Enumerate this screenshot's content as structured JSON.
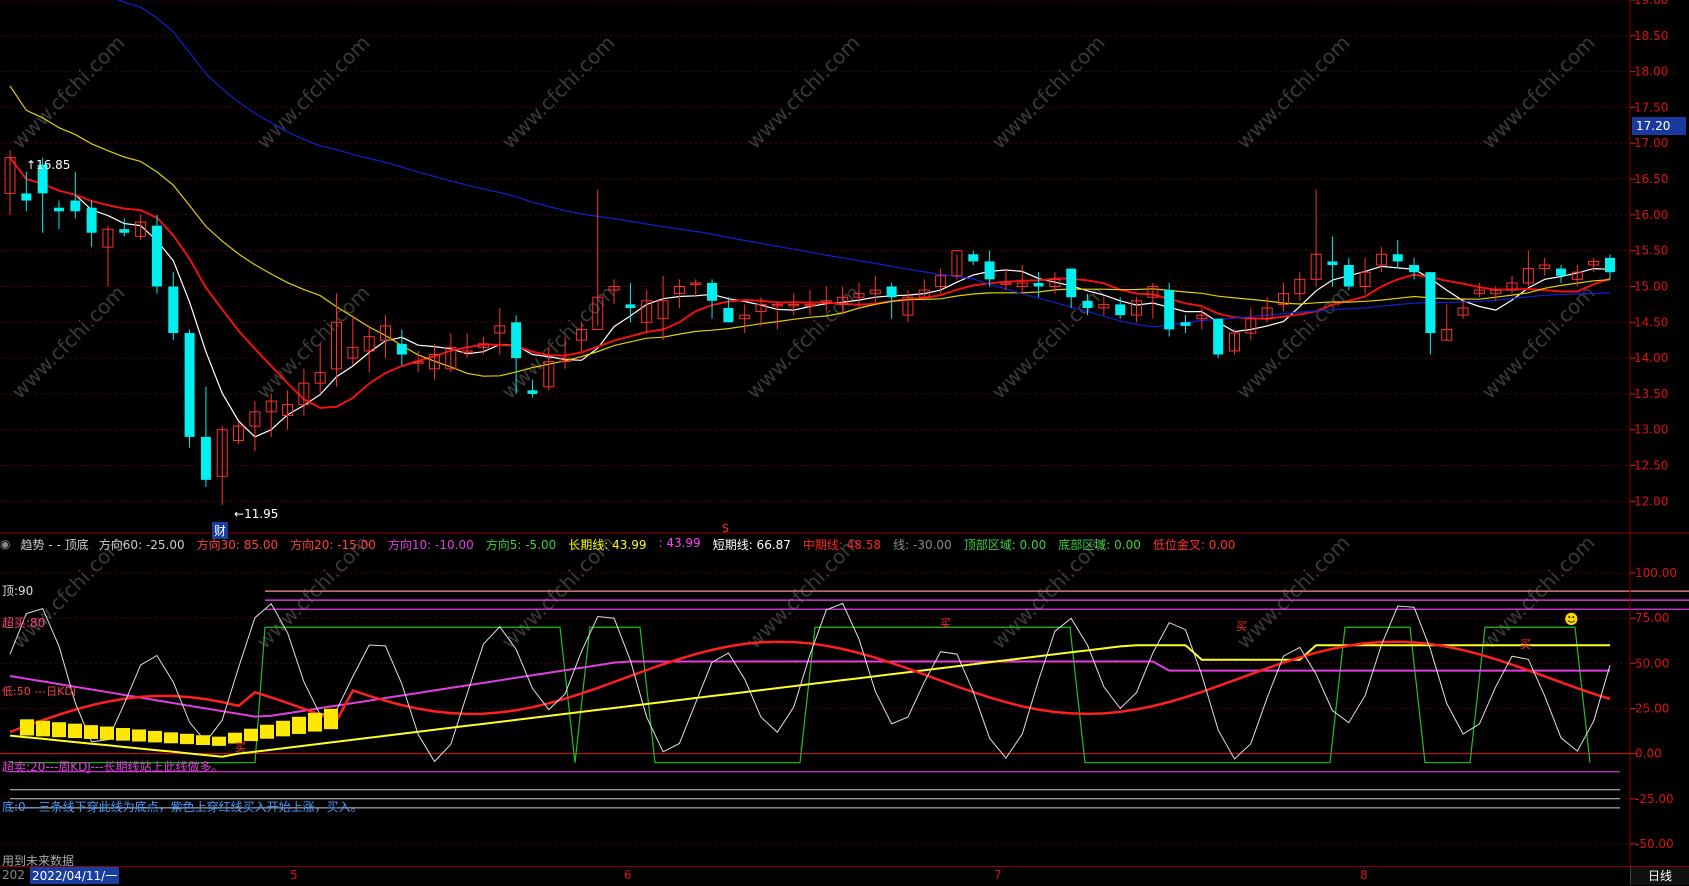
{
  "chart_data": [
    {
      "type": "candlestick",
      "title": "",
      "price_axis": {
        "ylim": [
          11.6,
          19.0
        ],
        "ticks": [
          "19.00",
          "18.50",
          "18.00",
          "17.50",
          "17.00",
          "16.50",
          "16.00",
          "15.50",
          "15.00",
          "14.50",
          "14.00",
          "13.50",
          "13.00",
          "12.50",
          "12.00"
        ],
        "current_price": "17.20"
      },
      "annotations": {
        "high": "16.85",
        "low": "11.95",
        "finance_marker": "财",
        "s_marker": "S"
      },
      "series": [
        {
          "name": "K",
          "candles": [
            [
              16.3,
              16.8,
              16.9,
              16.0
            ],
            [
              16.3,
              16.2,
              16.6,
              16.05
            ],
            [
              16.7,
              16.3,
              16.8,
              15.75
            ],
            [
              16.1,
              16.05,
              16.2,
              15.8
            ],
            [
              16.2,
              16.05,
              16.6,
              15.95
            ],
            [
              16.1,
              15.75,
              16.2,
              15.55
            ],
            [
              15.55,
              15.8,
              15.85,
              15.0
            ],
            [
              15.8,
              15.75,
              15.95,
              15.7
            ],
            [
              15.7,
              15.9,
              16.0,
              15.65
            ],
            [
              15.85,
              15.0,
              16.0,
              14.9
            ],
            [
              15.0,
              14.35,
              15.2,
              14.25
            ],
            [
              14.35,
              12.9,
              14.4,
              12.75
            ],
            [
              12.9,
              12.3,
              13.6,
              12.2
            ],
            [
              12.35,
              13.0,
              13.05,
              11.95
            ],
            [
              12.85,
              13.05,
              13.1,
              12.8
            ],
            [
              13.05,
              13.25,
              13.4,
              12.7
            ],
            [
              13.25,
              13.4,
              13.5,
              12.9
            ],
            [
              13.2,
              13.35,
              13.55,
              13.0
            ],
            [
              13.35,
              13.65,
              13.85,
              13.2
            ],
            [
              13.65,
              13.8,
              14.2,
              13.5
            ],
            [
              13.85,
              14.5,
              14.9,
              13.6
            ],
            [
              14.0,
              14.15,
              14.6,
              13.9
            ],
            [
              14.1,
              14.3,
              14.45,
              13.8
            ],
            [
              14.25,
              14.45,
              14.6,
              14.0
            ],
            [
              14.2,
              14.05,
              14.4,
              13.9
            ],
            [
              13.95,
              13.95,
              14.1,
              13.8
            ],
            [
              13.85,
              14.05,
              14.2,
              13.7
            ],
            [
              13.85,
              14.15,
              14.35,
              13.8
            ],
            [
              14.1,
              14.1,
              14.35,
              14.0
            ],
            [
              14.15,
              14.2,
              14.3,
              14.05
            ],
            [
              14.35,
              14.45,
              14.7,
              14.05
            ],
            [
              14.5,
              14.0,
              14.6,
              13.5
            ],
            [
              13.55,
              13.5,
              13.7,
              13.45
            ],
            [
              13.6,
              13.95,
              14.15,
              13.55
            ],
            [
              13.95,
              14.0,
              14.3,
              13.85
            ],
            [
              14.25,
              14.4,
              14.5,
              14.1
            ],
            [
              14.4,
              14.85,
              16.35,
              14.45
            ],
            [
              14.95,
              15.0,
              15.1,
              14.75
            ],
            [
              14.75,
              14.7,
              15.05,
              14.5
            ],
            [
              14.5,
              14.8,
              14.95,
              14.35
            ],
            [
              14.55,
              14.8,
              15.15,
              14.25
            ],
            [
              14.9,
              15.0,
              15.1,
              14.7
            ],
            [
              15.05,
              15.05,
              15.1,
              14.85
            ],
            [
              15.05,
              14.8,
              15.1,
              14.55
            ],
            [
              14.7,
              14.5,
              14.85,
              14.5
            ],
            [
              14.55,
              14.6,
              14.75,
              14.35
            ],
            [
              14.65,
              14.75,
              14.85,
              14.45
            ],
            [
              14.75,
              14.75,
              14.8,
              14.4
            ],
            [
              14.75,
              14.75,
              14.9,
              14.6
            ],
            [
              14.75,
              14.75,
              14.95,
              14.6
            ],
            [
              14.8,
              14.8,
              15.0,
              14.65
            ],
            [
              14.75,
              14.85,
              15.0,
              14.6
            ],
            [
              14.85,
              14.9,
              15.05,
              14.7
            ],
            [
              14.9,
              14.95,
              15.15,
              14.75
            ],
            [
              15.0,
              14.85,
              15.05,
              14.55
            ],
            [
              14.6,
              14.85,
              14.95,
              14.5
            ],
            [
              14.85,
              14.95,
              15.1,
              14.8
            ],
            [
              15.0,
              15.15,
              15.25,
              14.9
            ],
            [
              15.15,
              15.5,
              15.45,
              15.1
            ],
            [
              15.45,
              15.35,
              15.5,
              15.3
            ],
            [
              15.35,
              15.1,
              15.5,
              15.0
            ],
            [
              15.05,
              15.05,
              15.25,
              14.95
            ],
            [
              15.0,
              15.05,
              15.3,
              14.9
            ],
            [
              15.05,
              15.0,
              15.2,
              14.85
            ],
            [
              15.0,
              15.1,
              15.2,
              14.9
            ],
            [
              15.25,
              14.85,
              15.25,
              14.7
            ],
            [
              14.8,
              14.7,
              14.9,
              14.6
            ],
            [
              14.7,
              14.75,
              14.85,
              14.6
            ],
            [
              14.75,
              14.6,
              14.85,
              14.55
            ],
            [
              14.6,
              14.8,
              14.85,
              14.5
            ],
            [
              14.85,
              15.0,
              15.05,
              14.55
            ],
            [
              14.95,
              14.4,
              15.05,
              14.3
            ],
            [
              14.5,
              14.45,
              14.6,
              14.35
            ],
            [
              14.55,
              14.6,
              14.7,
              14.4
            ],
            [
              14.55,
              14.05,
              14.55,
              14.0
            ],
            [
              14.1,
              14.35,
              14.4,
              14.05
            ],
            [
              14.35,
              14.55,
              14.7,
              14.25
            ],
            [
              14.55,
              14.7,
              14.85,
              14.5
            ],
            [
              14.75,
              14.9,
              15.05,
              14.65
            ],
            [
              14.9,
              15.1,
              15.2,
              14.8
            ],
            [
              15.1,
              15.45,
              16.35,
              15.0
            ],
            [
              15.35,
              15.3,
              15.7,
              15.0
            ],
            [
              15.3,
              15.0,
              15.4,
              14.95
            ],
            [
              15.0,
              15.2,
              15.4,
              14.9
            ],
            [
              15.3,
              15.45,
              15.55,
              15.2
            ],
            [
              15.45,
              15.35,
              15.65,
              15.25
            ],
            [
              15.3,
              15.2,
              15.4,
              15.1
            ],
            [
              15.2,
              14.35,
              15.2,
              14.05
            ],
            [
              14.25,
              14.4,
              14.75,
              14.25
            ],
            [
              14.6,
              14.7,
              14.8,
              14.55
            ],
            [
              14.9,
              14.95,
              15.05,
              14.85
            ],
            [
              14.9,
              14.95,
              15.0,
              14.8
            ],
            [
              14.95,
              15.05,
              15.15,
              14.9
            ],
            [
              15.05,
              15.25,
              15.5,
              15.0
            ],
            [
              15.25,
              15.3,
              15.4,
              15.15
            ],
            [
              15.25,
              15.15,
              15.3,
              15.05
            ],
            [
              15.1,
              15.2,
              15.3,
              15.0
            ],
            [
              15.3,
              15.35,
              15.4,
              15.2
            ],
            [
              15.4,
              15.2,
              15.45,
              15.1
            ]
          ]
        }
      ],
      "moving_averages": [
        {
          "name": "MA-white",
          "color": "#ffffff"
        },
        {
          "name": "MA-red",
          "color": "#ee1111"
        },
        {
          "name": "MA-yellow",
          "color": "#e0d000"
        },
        {
          "name": "MA-blue",
          "color": "#1020d0"
        }
      ]
    },
    {
      "type": "line",
      "title": "趋势",
      "ylim": [
        -60,
        110
      ],
      "ticks": [
        "100.00",
        "75.00",
        "50.00",
        "25.00",
        "0.00",
        "-25.00",
        "-50.00"
      ],
      "series": [
        {
          "name": "方向60",
          "value": "-25.00",
          "color": "#cccccc"
        },
        {
          "name": "方向30",
          "value": "85.00",
          "color": "#ff4040"
        },
        {
          "name": "方向20",
          "value": "-15.00",
          "color": "#ff4040"
        },
        {
          "name": "方向10",
          "value": "-10.00",
          "color": "#e040e0"
        },
        {
          "name": "方向5",
          "value": "-5.00",
          "color": "#40d040"
        },
        {
          "name": "长期线",
          "value": "43.99",
          "color": "#ffff00"
        },
        {
          "name": "短期线",
          "value": "66.87",
          "color": "#ffffff"
        },
        {
          "name": "中期线",
          "value": "48.58",
          "color": "#ff2020"
        },
        {
          "name": "线",
          "value": "-30.00",
          "color": "#999999"
        },
        {
          "name": "顶部区域",
          "value": "0.00",
          "color": "#40d040"
        },
        {
          "name": "底部区域",
          "value": "0.00",
          "color": "#40d040"
        },
        {
          "name": "低位金叉",
          "value": "0.00",
          "color": "#ff3030"
        }
      ]
    }
  ],
  "indicator_header": {
    "title": "趋势 -",
    "subtitle": "- 顶底",
    "items": [
      {
        "label": "方向60:",
        "value": "-25.00",
        "color": "#cccccc"
      },
      {
        "label": "方向30:",
        "value": "85.00",
        "color": "#ff4040"
      },
      {
        "label": "方向20:",
        "value": "-15.00",
        "color": "#ff4040"
      },
      {
        "label": "方向10:",
        "value": "-10.00",
        "color": "#e040e0"
      },
      {
        "label": "方向5:",
        "value": "-5.00",
        "color": "#40d040"
      },
      {
        "label": "长期线:",
        "value": "43.99",
        "color": "#ffff00"
      },
      {
        "label": ":",
        "value": "43.99",
        "color": "#ff40ff"
      },
      {
        "label": "短期线:",
        "value": "66.87",
        "color": "#ffffff"
      },
      {
        "label": "中期线:",
        "value": "48.58",
        "color": "#ff2020"
      },
      {
        "label": "线:",
        "value": "-30.00",
        "color": "#888888"
      },
      {
        "label": "顶部区域:",
        "value": "0.00",
        "color": "#40d040"
      },
      {
        "label": "底部区域:",
        "value": "0.00",
        "color": "#40d040"
      },
      {
        "label": "低位金叉:",
        "value": "0.00",
        "color": "#ff3030"
      }
    ]
  },
  "sub_labels": {
    "top": "顶:90",
    "overbought": "超买:80",
    "low_text": "低:50 ---日KDJ",
    "buy1": "买",
    "buy2": "买",
    "buy3": "买",
    "buy4": "买",
    "oversold": "超卖:20---周KDJ---长期线站上此线做多。",
    "bottom": "底:0---三条线下穿此线为底点，紫色上穿红线买入开始上涨，买入。",
    "future": "用到未来数据"
  },
  "time_axis": {
    "date": "2022/04/11/一",
    "prefix": "202",
    "months": [
      "5",
      "6",
      "7",
      "8"
    ],
    "period_tab": "日线"
  },
  "watermark": "www.cfchi.com"
}
